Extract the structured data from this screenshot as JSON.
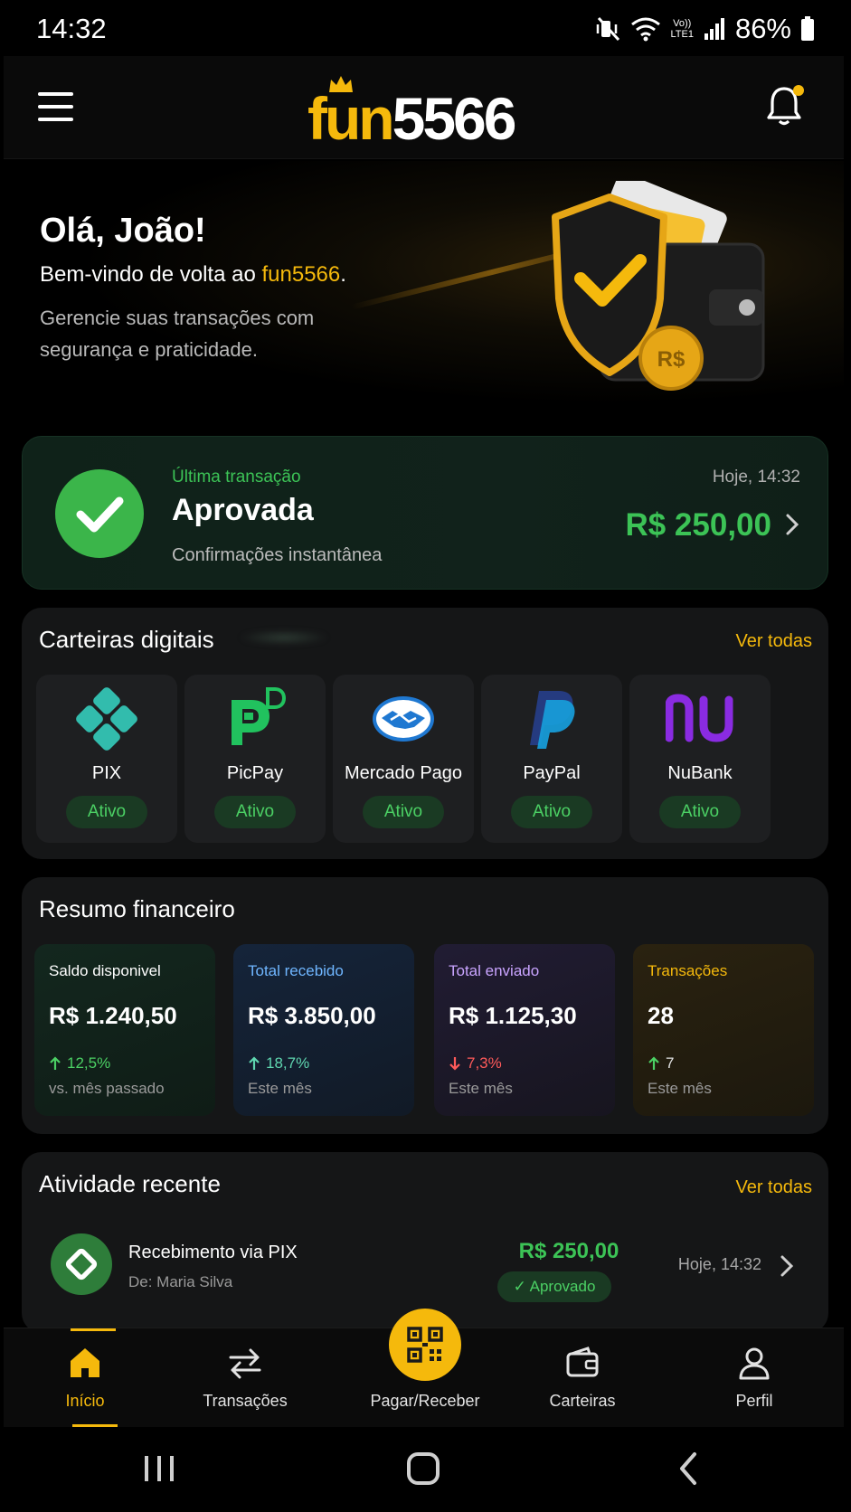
{
  "status_bar": {
    "time": "14:32",
    "battery": "86%",
    "network": "LTE1",
    "icons": [
      "mute-vibrate-icon",
      "wifi-icon",
      "volte-icon",
      "signal-icon",
      "battery-icon"
    ]
  },
  "header": {
    "logo_part1": "fun",
    "logo_part2": "5566",
    "notification_dot": true
  },
  "hero": {
    "title": "Olá, João!",
    "subtitle_prefix": "Bem-vindo de volta ao ",
    "subtitle_brand": "fun5566",
    "subtitle_suffix": ".",
    "description": "Gerencie suas transações com segurança e praticidade.",
    "coin_label": "R$"
  },
  "last_transaction": {
    "label": "Última transação",
    "status": "Aprovada",
    "description": "Confirmações instantânea",
    "time": "Hoje, 14:32",
    "amount": "R$ 250,00"
  },
  "wallets": {
    "title": "Carteiras digitais",
    "see_all": "Ver todas",
    "items": [
      {
        "name": "PIX",
        "status": "Ativo",
        "icon": "pix-icon"
      },
      {
        "name": "PicPay",
        "status": "Ativo",
        "icon": "picpay-icon"
      },
      {
        "name": "Mercado Pago",
        "status": "Ativo",
        "icon": "mercado-pago-icon"
      },
      {
        "name": "PayPal",
        "status": "Ativo",
        "icon": "paypal-icon"
      },
      {
        "name": "NuBank",
        "status": "Ativo",
        "icon": "nubank-icon"
      }
    ]
  },
  "summary": {
    "title": "Resumo financeiro",
    "items": [
      {
        "label": "Saldo disponivel",
        "value": "R$ 1.240,50",
        "change": "12,5%",
        "direction": "up",
        "note": "vs. mês passado",
        "label_color": "#ffffff",
        "change_color": "#4bd064",
        "bg": "#12231b"
      },
      {
        "label": "Total recebido",
        "value": "R$ 3.850,00",
        "change": "18,7%",
        "direction": "up",
        "note": "Este mês",
        "label_color": "#6fb6ff",
        "change_color": "#5fd6b0",
        "bg": "#131e2a"
      },
      {
        "label": "Total enviado",
        "value": "R$ 1.125,30",
        "change": "7,3%",
        "direction": "down",
        "note": "Este mês",
        "label_color": "#c9a4ff",
        "change_color": "#ff5a5a",
        "bg": "#1b1827"
      },
      {
        "label": "Transações",
        "value": "28",
        "change": "7",
        "direction": "up",
        "note": "Este mês",
        "label_color": "#f5b90c",
        "change_color": "#4bd064",
        "bg": "#221d10"
      }
    ]
  },
  "activity": {
    "title": "Atividade recente",
    "see_all": "Ver todas",
    "items": [
      {
        "title": "Recebimento via PIX",
        "from": "De: Maria Silva",
        "amount": "R$ 250,00",
        "status": "Aprovado",
        "time": "Hoje, 14:32"
      }
    ]
  },
  "bottom_nav": {
    "items": [
      {
        "label": "Início",
        "icon": "home-icon",
        "active": true
      },
      {
        "label": "Transações",
        "icon": "transfer-arrows-icon",
        "active": false
      },
      {
        "label": "Pagar/Receber",
        "icon": "qr-code-icon",
        "active": false
      },
      {
        "label": "Carteiras",
        "icon": "wallet-icon",
        "active": false
      },
      {
        "label": "Perfil",
        "icon": "user-icon",
        "active": false
      }
    ]
  },
  "colors": {
    "accent": "#f5b90c",
    "success": "#3cc356",
    "danger": "#ff5a5a",
    "background": "#000000"
  }
}
